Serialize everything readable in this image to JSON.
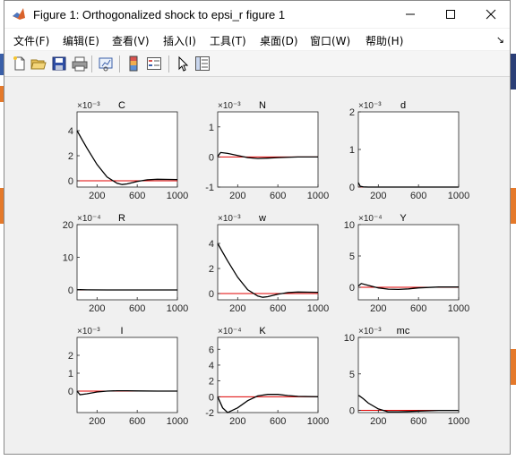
{
  "window": {
    "title": "Figure 1: Orthogonalized shock to epsi_r figure 1"
  },
  "menu": {
    "items": [
      "文件(F)",
      "编辑(E)",
      "查看(V)",
      "插入(I)",
      "工具(T)",
      "桌面(D)",
      "窗口(W)",
      "帮助(H)"
    ],
    "dock_icon": "↘"
  },
  "toolbar": {
    "buttons": [
      "new-figure-icon",
      "open-file-icon",
      "save-icon",
      "print-icon",
      "link-plot-icon",
      "insert-colorbar-icon",
      "insert-legend-icon",
      "edit-plot-arrow-icon",
      "property-editor-icon"
    ]
  },
  "colors": {
    "response": "#000000",
    "zero_line": "#e00000",
    "axes_bg": "#ffffff",
    "figure_bg": "#f0f0f0"
  },
  "chart_data": [
    {
      "type": "line",
      "title": "C",
      "exponent": "×10⁻³",
      "xlim": [
        1,
        1000
      ],
      "xticks": [
        "200",
        "600",
        "1000"
      ],
      "ylim": [
        -0.5,
        5.5
      ],
      "yticks": [
        "0",
        "2",
        "4"
      ],
      "x": [
        1,
        50,
        100,
        200,
        300,
        400,
        450,
        500,
        600,
        700,
        800,
        1000
      ],
      "y": [
        4.0,
        3.3,
        2.6,
        1.3,
        0.3,
        -0.2,
        -0.3,
        -0.25,
        -0.05,
        0.08,
        0.12,
        0.1
      ]
    },
    {
      "type": "line",
      "title": "N",
      "exponent": "×10⁻³",
      "xlim": [
        1,
        1000
      ],
      "xticks": [
        "200",
        "600",
        "1000"
      ],
      "ylim": [
        -1,
        1.5
      ],
      "yticks": [
        "-1",
        "0",
        "1"
      ],
      "x": [
        1,
        30,
        100,
        200,
        300,
        400,
        500,
        600,
        800,
        1000
      ],
      "y": [
        0.02,
        0.15,
        0.12,
        0.05,
        -0.02,
        -0.05,
        -0.04,
        -0.02,
        0.0,
        0.0
      ]
    },
    {
      "type": "line",
      "title": "d",
      "exponent": "×10⁻³",
      "xlim": [
        1,
        1000
      ],
      "xticks": [
        "200",
        "600",
        "1000"
      ],
      "ylim": [
        0,
        2
      ],
      "yticks": [
        "0",
        "1",
        "2"
      ],
      "x": [
        1,
        20,
        50,
        100,
        300,
        600,
        1000
      ],
      "y": [
        0.12,
        0.02,
        0.005,
        0.0,
        0.0,
        0.0,
        0.0
      ]
    },
    {
      "type": "line",
      "title": "R",
      "exponent": "×10⁻⁴",
      "xlim": [
        1,
        1000
      ],
      "xticks": [
        "200",
        "600",
        "1000"
      ],
      "ylim": [
        -3,
        20
      ],
      "yticks": [
        "0",
        "10",
        "20"
      ],
      "x": [
        1,
        10,
        30,
        100,
        300,
        600,
        1000
      ],
      "y": [
        0,
        0.1,
        0.1,
        0.05,
        0.0,
        0.0,
        0.0
      ]
    },
    {
      "type": "line",
      "title": "w",
      "exponent": "×10⁻³",
      "xlim": [
        1,
        1000
      ],
      "xticks": [
        "200",
        "600",
        "1000"
      ],
      "ylim": [
        -0.5,
        5.5
      ],
      "yticks": [
        "0",
        "2",
        "4"
      ],
      "x": [
        1,
        50,
        100,
        200,
        300,
        400,
        450,
        500,
        600,
        700,
        800,
        1000
      ],
      "y": [
        4.0,
        3.3,
        2.6,
        1.3,
        0.3,
        -0.2,
        -0.3,
        -0.25,
        -0.05,
        0.08,
        0.12,
        0.1
      ]
    },
    {
      "type": "line",
      "title": "Y",
      "exponent": "×10⁻⁴",
      "xlim": [
        1,
        1000
      ],
      "xticks": [
        "200",
        "600",
        "1000"
      ],
      "ylim": [
        -2,
        10
      ],
      "yticks": [
        "0",
        "5",
        "10"
      ],
      "x": [
        1,
        30,
        100,
        200,
        300,
        400,
        500,
        600,
        800,
        1000
      ],
      "y": [
        0.2,
        0.6,
        0.3,
        -0.1,
        -0.3,
        -0.35,
        -0.25,
        -0.1,
        0.05,
        0.05
      ]
    },
    {
      "type": "line",
      "title": "I",
      "exponent": "×10⁻³",
      "xlim": [
        1,
        1000
      ],
      "xticks": [
        "200",
        "600",
        "1000"
      ],
      "ylim": [
        -1.2,
        3
      ],
      "yticks": [
        "0",
        "1",
        "2"
      ],
      "x": [
        1,
        30,
        100,
        200,
        300,
        400,
        500,
        600,
        800,
        1000
      ],
      "y": [
        0.0,
        -0.2,
        -0.15,
        -0.05,
        0.0,
        0.02,
        0.02,
        0.01,
        0.0,
        0.0
      ]
    },
    {
      "type": "line",
      "title": "K",
      "exponent": "×10⁻⁴",
      "xlim": [
        1,
        1000
      ],
      "xticks": [
        "200",
        "600",
        "1000"
      ],
      "ylim": [
        -2,
        7.5
      ],
      "yticks": [
        "-2",
        "0",
        "2",
        "4",
        "6"
      ],
      "x": [
        1,
        50,
        100,
        200,
        300,
        400,
        500,
        600,
        700,
        800,
        1000
      ],
      "y": [
        0.0,
        -1.4,
        -2.0,
        -1.4,
        -0.5,
        0.1,
        0.3,
        0.3,
        0.15,
        0.05,
        0.0
      ]
    },
    {
      "type": "line",
      "title": "mc",
      "exponent": "×10⁻³",
      "xlim": [
        1,
        1000
      ],
      "xticks": [
        "200",
        "600",
        "1000"
      ],
      "ylim": [
        -0.3,
        10
      ],
      "yticks": [
        "0",
        "5",
        "10"
      ],
      "x": [
        1,
        10,
        50,
        100,
        200,
        300,
        400,
        600,
        800,
        1000
      ],
      "y": [
        2.0,
        2.0,
        1.6,
        1.0,
        0.2,
        -0.2,
        -0.2,
        -0.1,
        0.0,
        0.0
      ]
    }
  ]
}
